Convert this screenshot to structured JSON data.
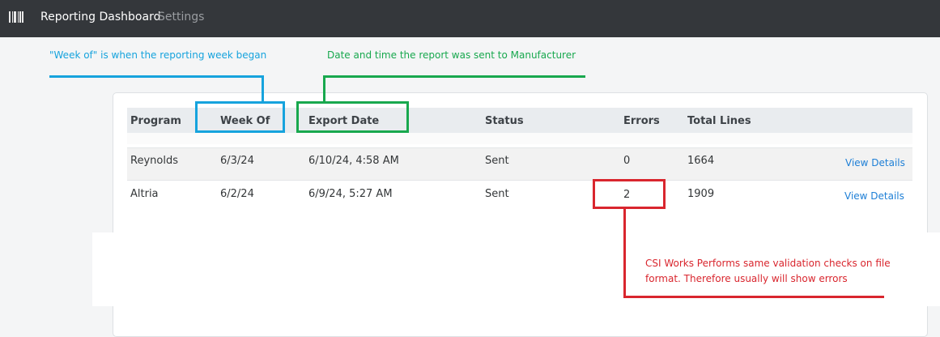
{
  "navbar": {
    "icon": "barcode-icon",
    "title": "Reporting Dashboard",
    "settings_link": "Settings",
    "background": "#34373b"
  },
  "annotations": {
    "week_of_note": "\"Week of\" is when the reporting week began",
    "export_date_note": "Date and time the report was sent to Manufacturer",
    "errors_note": "CSI Works Performs same validation checks on file format. Therefore usually will show errors",
    "colors": {
      "cyan": "#16a3dd",
      "green": "#18a84e",
      "red": "#d9262e"
    }
  },
  "table": {
    "headers": {
      "program": "Program",
      "week_of": "Week Of",
      "export_date": "Export Date",
      "status": "Status",
      "errors": "Errors",
      "total_lines": "Total Lines"
    },
    "rows": [
      {
        "program": "Reynolds",
        "week_of": "6/3/24",
        "export_date": "6/10/24, 4:58 AM",
        "status": "Sent",
        "errors": "0",
        "total_lines": "1664",
        "action": "View Details"
      },
      {
        "program": "Altria",
        "week_of": "6/2/24",
        "export_date": "6/9/24, 5:27 AM",
        "status": "Sent",
        "errors": "2",
        "total_lines": "1909",
        "action": "View Details"
      }
    ]
  }
}
